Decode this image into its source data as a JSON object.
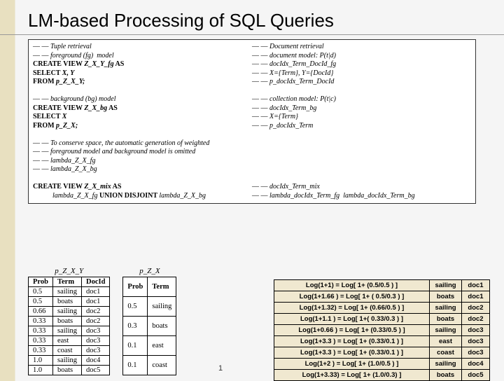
{
  "title": "LM-based Processing of SQL Queries",
  "sql": {
    "left": [
      {
        "cls": "",
        "pre": "— — ",
        "italic": "Tuple retrieval",
        "post": ""
      },
      {
        "cls": "",
        "pre": "— — ",
        "italic": "foreground (fg)  model",
        "post": ""
      },
      {
        "cls": "bold",
        "pre": "CREATE VIEW ",
        "italic": "Z_X_Y_fg",
        "post": " AS"
      },
      {
        "cls": "bold",
        "pre": "SELECT ",
        "italic": "X, Y",
        "post": ""
      },
      {
        "cls": "bold",
        "pre": "FROM ",
        "italic": "p_Z_X_Y;",
        "post": ""
      },
      {
        "cls": "",
        "pre": "",
        "italic": "",
        "post": ""
      },
      {
        "cls": "",
        "pre": "— — ",
        "italic": "background (bg) model",
        "post": ""
      },
      {
        "cls": "bold",
        "pre": "CREATE VIEW ",
        "italic": "Z_X_bg",
        "post": " AS"
      },
      {
        "cls": "bold",
        "pre": "SELECT ",
        "italic": "X",
        "post": ""
      },
      {
        "cls": "bold",
        "pre": "FROM ",
        "italic": "p_Z_X;",
        "post": ""
      },
      {
        "cls": "",
        "pre": "",
        "italic": "",
        "post": ""
      },
      {
        "cls": "",
        "pre": "— — ",
        "italic": "To conserve space, the automatic generation of weighted",
        "post": ""
      },
      {
        "cls": "",
        "pre": "— — ",
        "italic": "foreground model and background model is omitted",
        "post": ""
      },
      {
        "cls": "",
        "pre": "— — ",
        "italic": "lambda_Z_X_fg",
        "post": ""
      },
      {
        "cls": "",
        "pre": "— — ",
        "italic": "lambda_Z_X_bg",
        "post": ""
      },
      {
        "cls": "",
        "pre": "",
        "italic": "",
        "post": ""
      },
      {
        "cls": "bold",
        "pre": "CREATE VIEW ",
        "italic": "Z_X_mix",
        "post": " AS"
      },
      {
        "cls": "indent1",
        "pre": "",
        "italic": "lambda_Z_X_fg",
        "postBold": " UNION DISJOINT ",
        "postItalic": "lambda_Z_X_bg"
      }
    ],
    "right": [
      {
        "pre": "— — ",
        "italic": "Document retrieval"
      },
      {
        "pre": "— — ",
        "italic": "document model: P(t|d)"
      },
      {
        "pre": "— — ",
        "italic": "docIdx_Term_DocId_fg"
      },
      {
        "pre": "— — ",
        "italic": "X={Term}, Y={DocId}"
      },
      {
        "pre": "— — ",
        "italic": "p_docIdx_Term_DocId"
      },
      {
        "pre": "",
        "italic": ""
      },
      {
        "pre": "— — ",
        "italic": "collection model: P(t|c)"
      },
      {
        "pre": "— — ",
        "italic": "docIdx_Term_bg"
      },
      {
        "pre": "— — ",
        "italic": "X={Term}"
      },
      {
        "pre": "— — ",
        "italic": "p_docIdx_Term"
      },
      {
        "pre": "",
        "italic": ""
      },
      {
        "pre": "",
        "italic": ""
      },
      {
        "pre": "",
        "italic": ""
      },
      {
        "pre": "",
        "italic": ""
      },
      {
        "pre": "",
        "italic": ""
      },
      {
        "pre": "",
        "italic": ""
      },
      {
        "pre": "— — ",
        "italic": "docIdx_Term_mix"
      },
      {
        "pre": "— — ",
        "italic1": "lambda_docIdx_Term_fg",
        "italic2": "lambda_docIdx_Term_bg"
      }
    ]
  },
  "table1": {
    "caption": "p_Z_X_Y",
    "headers": [
      "Prob",
      "Term",
      "DocId"
    ],
    "rows": [
      [
        "0.5",
        "sailing",
        "doc1"
      ],
      [
        "0.5",
        "boats",
        "doc1"
      ],
      [
        "0.66",
        "sailing",
        "doc2"
      ],
      [
        "0.33",
        "boats",
        "doc2"
      ],
      [
        "0.33",
        "sailing",
        "doc3"
      ],
      [
        "0.33",
        "east",
        "doc3"
      ],
      [
        "0.33",
        "coast",
        "doc3"
      ],
      [
        "1.0",
        "sailing",
        "doc4"
      ],
      [
        "1.0",
        "boats",
        "doc5"
      ]
    ]
  },
  "table2": {
    "caption": "p_Z_X",
    "headers": [
      "Prob",
      "Term"
    ],
    "rows": [
      [
        "0.5",
        "sailing"
      ],
      [
        "0.3",
        "boats"
      ],
      [
        "0.1",
        "east"
      ],
      [
        "0.1",
        "coast"
      ]
    ]
  },
  "log_table": {
    "rows": [
      [
        "Log(1+1)  = Log[ 1+ (0.5/0.5 ) ]",
        "sailing",
        "doc1"
      ],
      [
        "Log(1+1.66 ) = Log[ 1+ ( 0.5/0.3 ) ]",
        "boats",
        "doc1"
      ],
      [
        "Log(1+1.32)  = Log[ 1+ (0.66/0.5 ) ]",
        "sailing",
        "doc2"
      ],
      [
        "Log(1+1.1 ) = Log[ 1+( 0.33/0.3 ) ]",
        "boats",
        "doc2"
      ],
      [
        "Log(1+0.66 ) = Log[ 1+ (0.33/0.5 ) ]",
        "sailing",
        "doc3"
      ],
      [
        "Log(1+3.3 ) = Log[ 1+ (0.33/0.1 ) ]",
        "east",
        "doc3"
      ],
      [
        "Log(1+3.3 ) = Log[ 1+ (0.33/0.1 ) ]",
        "coast",
        "doc3"
      ],
      [
        "Log(1+2 ) = Log[ 1+ (1.0/0.5 ) ]",
        "sailing",
        "doc4"
      ],
      [
        "Log(1+3.33)  = Log[ 1+ (1.0/0.3) ]",
        "boats",
        "doc5"
      ]
    ]
  },
  "slide_number": "1"
}
